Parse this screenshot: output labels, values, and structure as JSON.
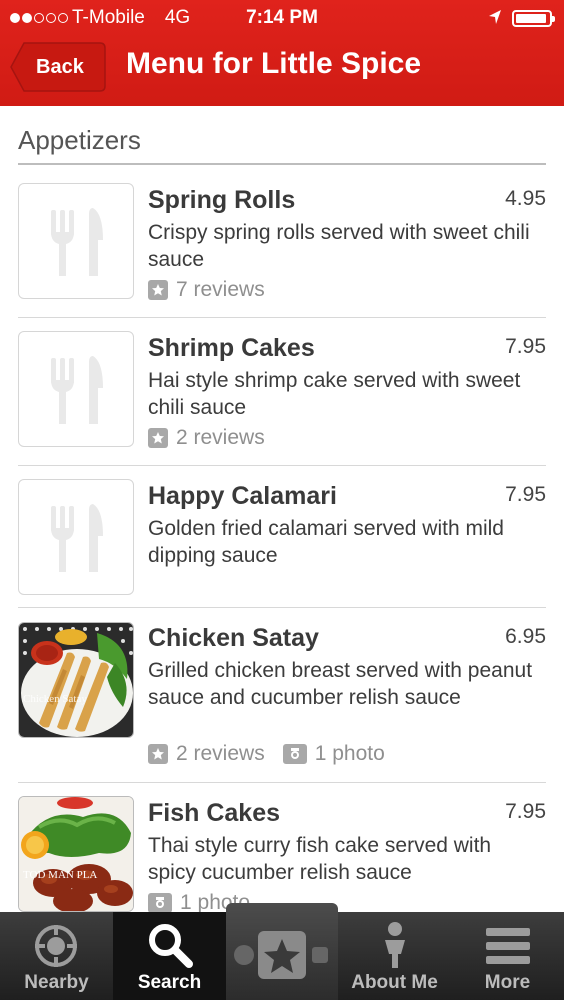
{
  "status_bar": {
    "carrier": "T-Mobile",
    "network": "4G",
    "time": "7:14 PM"
  },
  "nav": {
    "back_label": "Back",
    "title": "Menu for Little Spice"
  },
  "section": {
    "title": "Appetizers"
  },
  "items": [
    {
      "name": "Spring Rolls",
      "price": "4.95",
      "desc": "Crispy spring rolls served with sweet chili sauce",
      "reviews": "7 reviews",
      "photos": "",
      "image": "placeholder-fork-knife"
    },
    {
      "name": "Shrimp Cakes",
      "price": "7.95",
      "desc": "Hai style shrimp cake served with sweet chili sauce",
      "reviews": "2 reviews",
      "photos": "",
      "image": "placeholder-fork-knife"
    },
    {
      "name": "Happy Calamari",
      "price": "7.95",
      "desc": "Golden fried calamari served with mild dipping sauce",
      "reviews": "",
      "photos": "",
      "image": "placeholder-fork-knife"
    },
    {
      "name": "Chicken Satay",
      "price": "6.95",
      "desc": "Grilled chicken breast served with peanut sauce and cucumber relish sauce",
      "reviews": "2 reviews",
      "photos": "1 photo",
      "image": "chicken-satay-photo",
      "image_caption": "Chicken Satay"
    },
    {
      "name": "Fish Cakes",
      "price": "7.95",
      "desc": "Thai style curry fish cake served with spicy cucumber relish sauce",
      "reviews": "",
      "photos": "1 photo",
      "image": "fish-cakes-photo",
      "image_caption": "TOD MAN PLA"
    }
  ],
  "tabs": [
    {
      "label": "Nearby",
      "icon": "compass-icon"
    },
    {
      "label": "Search",
      "icon": "search-icon",
      "active": true
    },
    {
      "label": "",
      "icon": "check-in-star-icon"
    },
    {
      "label": "About Me",
      "icon": "person-icon"
    },
    {
      "label": "More",
      "icon": "menu-lines-icon"
    }
  ],
  "colors": {
    "brand_red": "#d01b14",
    "tab_bg": "#2a2a2a"
  }
}
